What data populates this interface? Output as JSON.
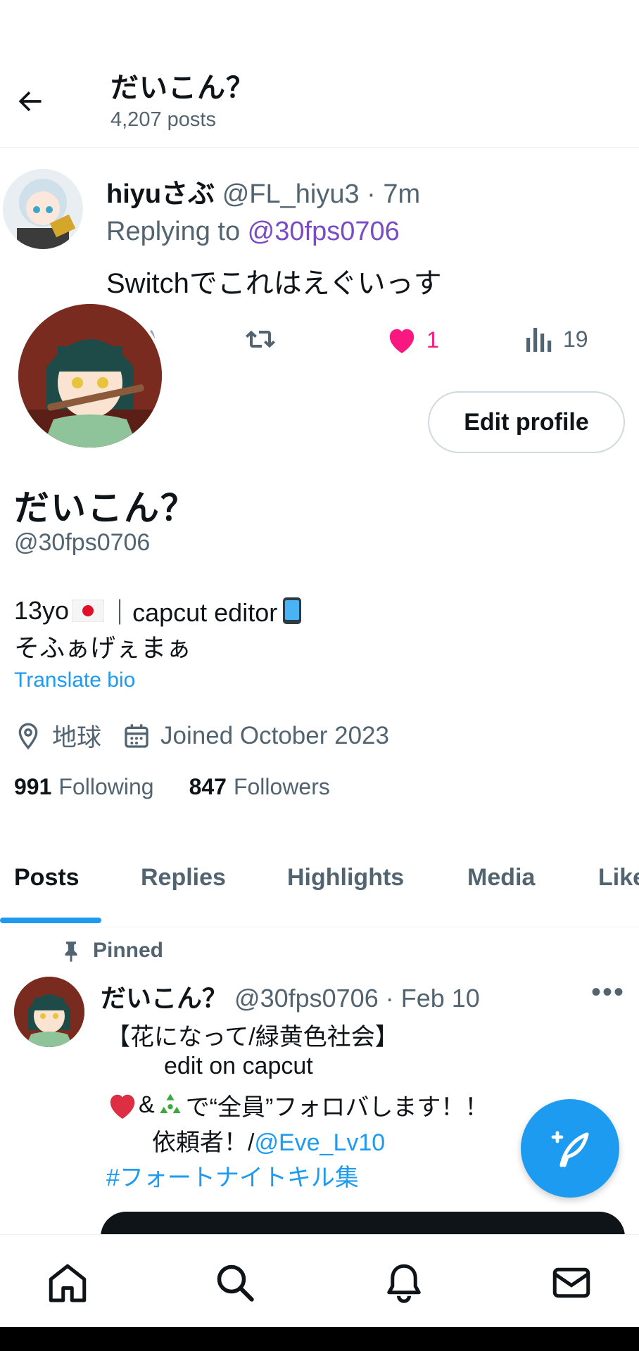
{
  "header": {
    "title": "だいこん？",
    "post_count": "4,207 posts"
  },
  "reply_overlay": {
    "name": "hiyuさぶ",
    "handle_time": "@FL_hiyu3 · 7m",
    "replying_label": "Replying to ",
    "replying_handle": "@30fps0706",
    "text": "Switchでこれはえぐいっす",
    "likes": "1",
    "views": "19"
  },
  "profile": {
    "edit_label": "Edit profile",
    "name": "だいこん？",
    "handle": "@30fps0706",
    "bio_line1_a": "13yo",
    "bio_line1_b": "｜capcut editor",
    "bio_line2": "そふぁげぇまぁ",
    "translate_label": "Translate bio",
    "location": "地球",
    "joined": "Joined October 2023",
    "following_count": "991",
    "following_label": "Following",
    "followers_count": "847",
    "followers_label": "Followers"
  },
  "tabs": [
    "Posts",
    "Replies",
    "Highlights",
    "Media",
    "Likes"
  ],
  "pinned_post": {
    "pinned_label": "Pinned",
    "name": "だいこん？",
    "meta": "@30fps0706 · Feb 10",
    "more": "•••",
    "line1": "【花になって/緑黄色社会】",
    "line2": "edit on capcut",
    "line3_b": "で“全員”フォロバします！！",
    "line4_a": "依頼者！/",
    "line4_link": "@Eve_Lv10",
    "line5": "#フォートナイトキル集"
  },
  "colors": {
    "accent": "#1d9bf0",
    "like": "#f91880",
    "mention": "#794bc4",
    "text_secondary": "#536471"
  },
  "icons": [
    "back-arrow-icon",
    "retweet-icon",
    "heart-icon",
    "views-icon",
    "location-icon",
    "calendar-icon",
    "pin-icon",
    "compose-icon",
    "home-icon",
    "search-icon",
    "bell-icon",
    "mail-icon"
  ]
}
